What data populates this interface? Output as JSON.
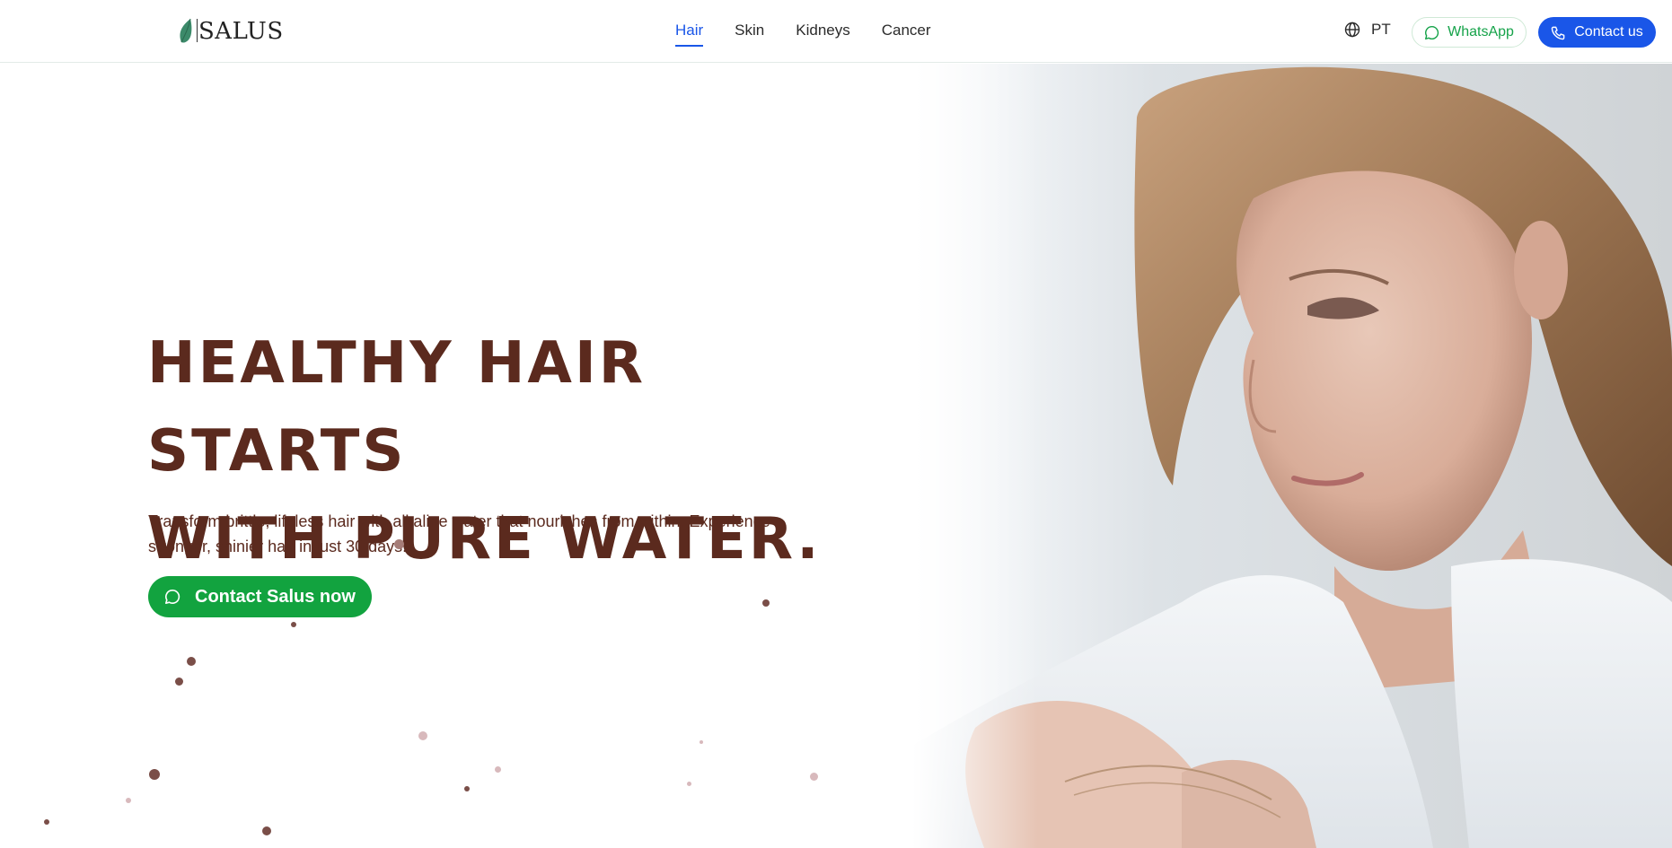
{
  "brand": {
    "name": "SALUS",
    "leaf_color": "#3c8a6a"
  },
  "nav": {
    "items": [
      {
        "label": "Hair",
        "active": true
      },
      {
        "label": "Skin",
        "active": false
      },
      {
        "label": "Kidneys",
        "active": false
      },
      {
        "label": "Cancer",
        "active": false
      }
    ]
  },
  "header": {
    "language_label": "PT",
    "language_icon": "globe-icon",
    "whatsapp_label": "WhatsApp",
    "whatsapp_icon": "chat-bubble-icon",
    "contact_label": "Contact us",
    "contact_icon": "phone-icon"
  },
  "hero": {
    "title_line1": "HEALTHY HAIR STARTS",
    "title_line2": "WITH PURE WATER.",
    "subtitle_line1": "Transform brittle, lifeless hair with alkaline water that nourishes from within. Experience",
    "subtitle_line2": "stronger, shinier hair in just 30 days.",
    "cta_label": "Contact Salus now",
    "cta_icon": "chat-bubble-icon",
    "image_subject": "woman-examining-hair-photo"
  },
  "colors": {
    "heading": "#5b2a1e",
    "nav_active": "#1a56e8",
    "whatsapp_green": "#16a34a",
    "cta_green": "#12a33f",
    "contact_blue": "#1a56e8"
  }
}
